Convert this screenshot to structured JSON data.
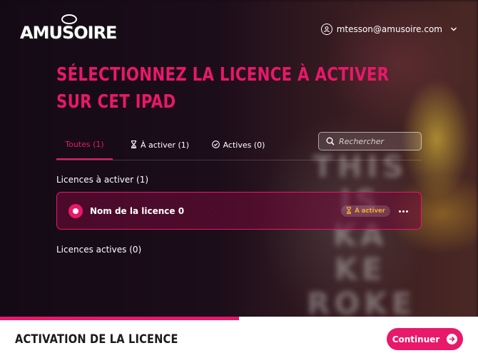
{
  "brand": {
    "logo_text": "AMUSOIRE"
  },
  "user": {
    "email": "mtesson@amusoire.com"
  },
  "background": {
    "neon_text": "THIS IS KA KE ROKE"
  },
  "page": {
    "title": "SÉLECTIONNEZ LA LICENCE À ACTIVER SUR CET IPAD"
  },
  "tabs": [
    {
      "label": "Toutes (1)",
      "active": true
    },
    {
      "label": "À activer (1)",
      "active": false
    },
    {
      "label": "Actives (0)",
      "active": false
    }
  ],
  "search": {
    "placeholder": "Rechercher",
    "value": ""
  },
  "sections": {
    "pending_label": "Licences à activer (1)",
    "active_label": "Licences actives (0)"
  },
  "licenses": [
    {
      "name": "Nom de la licence 0",
      "status": "À activer",
      "selected": true
    }
  ],
  "progress": {
    "fraction": 0.5
  },
  "footer": {
    "title": "ACTIVATION DE LA LICENCE",
    "continue_label": "Continuer"
  },
  "colors": {
    "accent": "#e8186a",
    "badge_text": "#f0a830",
    "background": "#130a14"
  },
  "icons": {
    "user": "user-circle-icon",
    "chevron": "chevron-down-icon",
    "hourglass": "hourglass-icon",
    "check": "check-circle-icon",
    "search": "search-icon",
    "more": "more-horizontal-icon",
    "arrow": "arrow-right-circle-icon"
  }
}
